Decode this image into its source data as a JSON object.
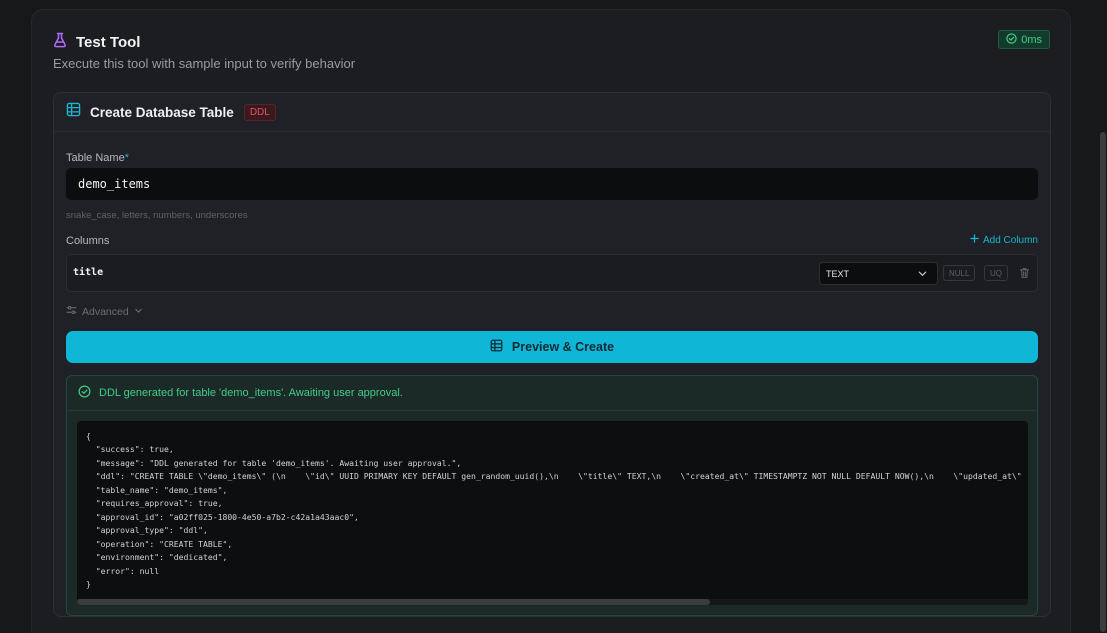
{
  "header": {
    "title": "Test Tool",
    "subtitle": "Execute this tool with sample input to verify behavior",
    "duration_badge": "0ms",
    "icon": "flask-icon"
  },
  "card": {
    "title": "Create Database Table",
    "tag": "DDL",
    "icon": "table-icon"
  },
  "form": {
    "table_name_label": "Table Name",
    "required_marker": "*",
    "table_name_value": "demo_items",
    "hint": "snake_case, letters, numbers, underscores",
    "columns_label": "Columns",
    "add_column_label": "Add Column",
    "columns": [
      {
        "name": "title",
        "type": "TEXT",
        "null_label": "NULL",
        "unique_label": "UQ"
      }
    ],
    "advanced_label": "Advanced",
    "submit_label": "Preview & Create"
  },
  "result": {
    "status_message": "DDL generated for table 'demo_items'. Awaiting user approval.",
    "status": "success",
    "code_lines": [
      "{",
      "  \"success\": true,",
      "  \"message\": \"DDL generated for table 'demo_items'. Awaiting user approval.\",",
      "  \"ddl\": \"CREATE TABLE \\\"demo_items\\\" (\\n    \\\"id\\\" UUID PRIMARY KEY DEFAULT gen_random_uuid(),\\n    \\\"title\\\" TEXT,\\n    \\\"created_at\\\" TIMESTAMPTZ NOT NULL DEFAULT NOW(),\\n    \\\"updated_at\\\"",
      "  \"table_name\": \"demo_items\",",
      "  \"requires_approval\": true,",
      "  \"approval_id\": \"a02ff025-1800-4e50-a7b2-c42a1a43aac0\",",
      "  \"approval_type\": \"ddl\",",
      "  \"operation\": \"CREATE TABLE\",",
      "  \"environment\": \"dedicated\",",
      "  \"error\": null",
      "}"
    ]
  },
  "colors": {
    "accent": "#10b6d6",
    "success": "#41cc8a",
    "danger": "#e05560",
    "icon_purple": "#b06bff"
  }
}
